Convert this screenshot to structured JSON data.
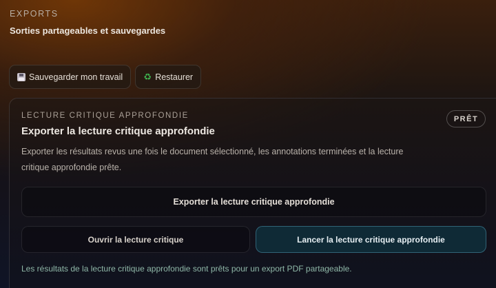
{
  "header": {
    "eyebrow": "EXPORTS",
    "subtitle": "Sorties partageables et sauvegardes"
  },
  "quick_actions": [
    {
      "label": "Sauvegarder mon travail",
      "icon": "floppy-disk-icon"
    },
    {
      "label": "Restaurer",
      "icon": "recycle-icon"
    }
  ],
  "card": {
    "eyebrow": "LECTURE CRITIQUE APPROFONDIE",
    "title": "Exporter la lecture critique approfondie",
    "description": "Exporter les résultats revus une fois le document sélectionné, les annotations terminées et la lecture critique approfondie prête.",
    "badge": "PRÊT",
    "export_button": "Exporter la lecture critique approfondie",
    "open_button": "Ouvrir la lecture critique",
    "launch_button": "Lancer la lecture critique approfondie",
    "footer_note": "Les résultats de la lecture critique approfondie sont prêts pour un export PDF partageable."
  },
  "colors": {
    "accent_button_bg": "#0f2a36",
    "accent_button_border": "#5aaac8",
    "footer_note": "#8fb8a8"
  }
}
